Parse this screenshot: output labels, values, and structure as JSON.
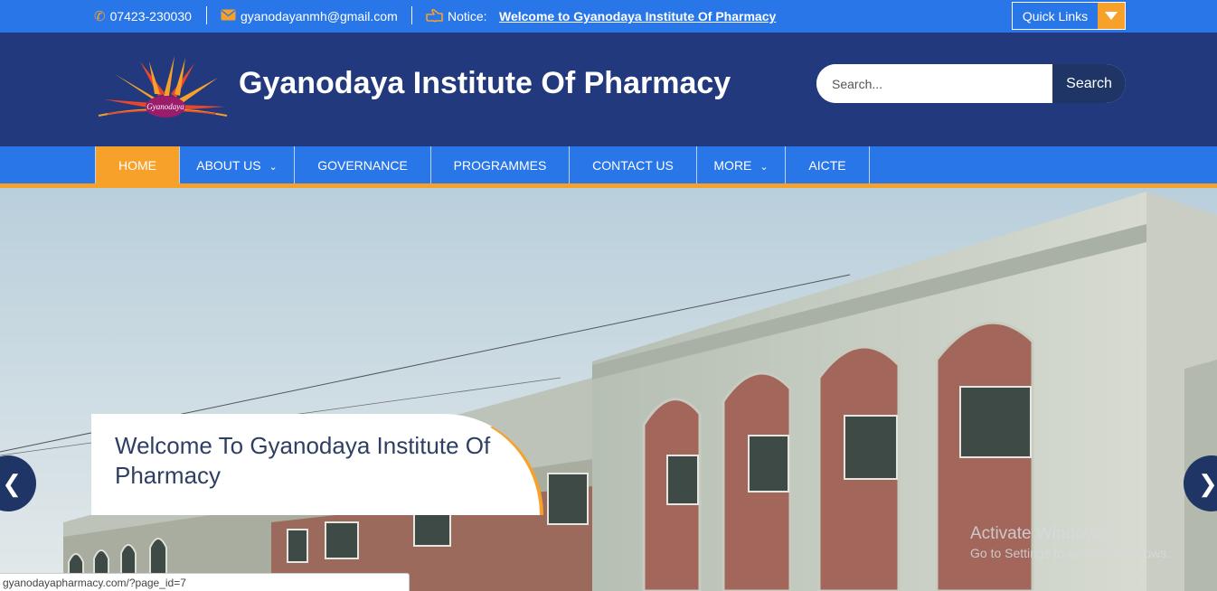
{
  "topbar": {
    "phone": "07423-230030",
    "email": "gyanodayanmh@gmail.com",
    "notice_label": "Notice:",
    "notice_link": "Welcome to Gyanodaya Institute Of Pharmacy",
    "quick_links": "Quick Links",
    "icons": {
      "phone": "phone-icon",
      "email": "envelope-icon",
      "notice": "hand-pointer-icon",
      "dropdown": "caret-down-icon"
    }
  },
  "header": {
    "logo_text": "Gyanodaya",
    "title": "Gyanodaya Institute Of Pharmacy",
    "search_placeholder": "Search...",
    "search_button": "Search"
  },
  "nav": {
    "items": [
      {
        "label": "HOME",
        "active": true,
        "has_dropdown": false
      },
      {
        "label": "ABOUT US",
        "active": false,
        "has_dropdown": true
      },
      {
        "label": "GOVERNANCE",
        "active": false,
        "has_dropdown": false
      },
      {
        "label": "PROGRAMMES",
        "active": false,
        "has_dropdown": false
      },
      {
        "label": "CONTACT US",
        "active": false,
        "has_dropdown": false
      },
      {
        "label": "MORE",
        "active": false,
        "has_dropdown": true
      },
      {
        "label": "AICTE",
        "active": false,
        "has_dropdown": false
      }
    ]
  },
  "hero": {
    "caption": "Welcome To Gyanodaya Institute Of Pharmacy",
    "prev_icon": "chevron-left-icon",
    "next_icon": "chevron-right-icon"
  },
  "watermark": {
    "line1": "Activate Windows",
    "line2": "Go to Settings to activate Windows."
  },
  "statusbar": {
    "url": "gyanodayapharmacy.com/?page_id=7"
  },
  "colors": {
    "topbar": "#2876e8",
    "header": "#223a7d",
    "accent": "#f7a12a",
    "dark_button": "#1e3565"
  }
}
